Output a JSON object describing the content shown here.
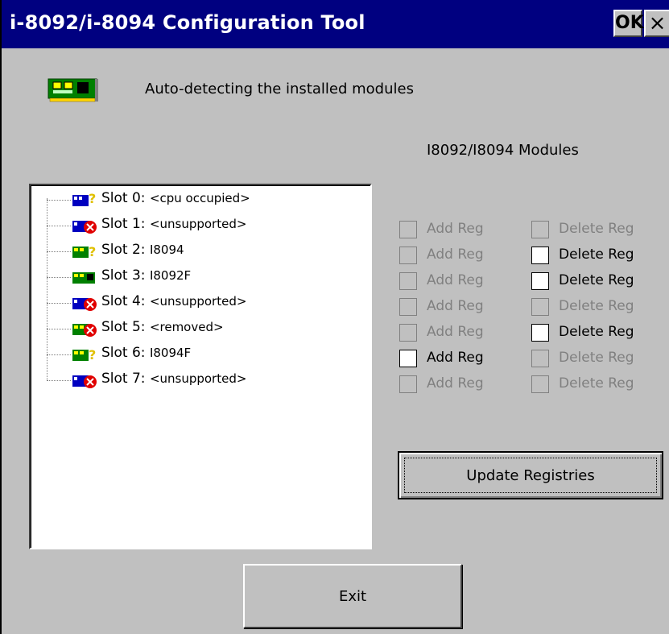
{
  "window": {
    "title": "i-8092/i-8094 Configuration Tool",
    "ok_label": "OK",
    "close_label": "×"
  },
  "header": {
    "icon": "circuit-board-icon",
    "text": "Auto-detecting the installed modules"
  },
  "group_label": "I8092/I8094 Modules",
  "slots": [
    {
      "label": "Slot 0:",
      "status": "<cpu occupied>",
      "icon": "cpu-question-icon"
    },
    {
      "label": "Slot 1:",
      "status": "<unsupported>",
      "icon": "module-error-icon"
    },
    {
      "label": "Slot 2:",
      "status": "I8094",
      "icon": "module-question-icon"
    },
    {
      "label": "Slot 3:",
      "status": "I8092F",
      "icon": "module-ok-icon"
    },
    {
      "label": "Slot 4:",
      "status": "<unsupported>",
      "icon": "module-error-icon"
    },
    {
      "label": "Slot 5:",
      "status": "<removed>",
      "icon": "module-removed-icon"
    },
    {
      "label": "Slot 6:",
      "status": "I8094F",
      "icon": "module-question-icon"
    },
    {
      "label": "Slot 7:",
      "status": "<unsupported>",
      "icon": "module-error-icon"
    }
  ],
  "add_reg": [
    {
      "label": "Add Reg",
      "enabled": false,
      "checked": false
    },
    {
      "label": "Add Reg",
      "enabled": false,
      "checked": false
    },
    {
      "label": "Add Reg",
      "enabled": false,
      "checked": false
    },
    {
      "label": "Add Reg",
      "enabled": false,
      "checked": false
    },
    {
      "label": "Add Reg",
      "enabled": false,
      "checked": false
    },
    {
      "label": "Add Reg",
      "enabled": true,
      "checked": false
    },
    {
      "label": "Add Reg",
      "enabled": false,
      "checked": false
    }
  ],
  "delete_reg": [
    {
      "label": "Delete Reg",
      "enabled": false,
      "checked": false
    },
    {
      "label": "Delete Reg",
      "enabled": true,
      "checked": false
    },
    {
      "label": "Delete Reg",
      "enabled": true,
      "checked": false
    },
    {
      "label": "Delete Reg",
      "enabled": false,
      "checked": false
    },
    {
      "label": "Delete Reg",
      "enabled": true,
      "checked": false
    },
    {
      "label": "Delete Reg",
      "enabled": false,
      "checked": false
    },
    {
      "label": "Delete Reg",
      "enabled": false,
      "checked": false
    }
  ],
  "buttons": {
    "update_label": "Update Registries",
    "exit_label": "Exit"
  },
  "colors": {
    "titlebar": "#000080",
    "face": "#c0c0c0",
    "disabled_text": "#808080"
  }
}
